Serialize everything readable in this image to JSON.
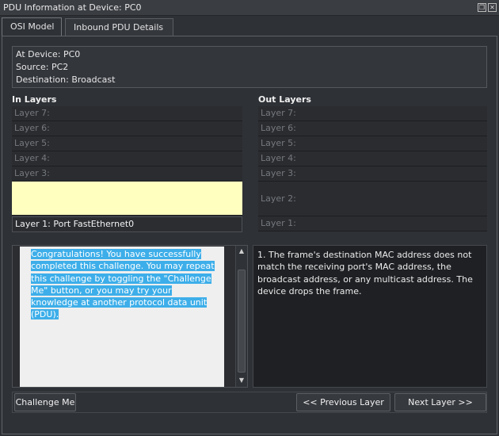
{
  "window": {
    "title": "PDU Information at Device: PC0"
  },
  "tabs": [
    {
      "label": "OSI Model",
      "active": true
    },
    {
      "label": "Inbound PDU Details",
      "active": false
    }
  ],
  "device_info": {
    "at_device": "At Device: PC0",
    "source": "Source: PC2",
    "destination": "Destination: Broadcast"
  },
  "in_layers": {
    "header": "In Layers",
    "layer7": "Layer 7:",
    "layer6": "Layer 6:",
    "layer5": "Layer 5:",
    "layer4": "Layer 4:",
    "layer3": "Layer 3:",
    "layer1": "Layer 1: Port FastEthernet0"
  },
  "out_layers": {
    "header": "Out Layers",
    "layer7": "Layer 7:",
    "layer6": "Layer 6:",
    "layer5": "Layer 5:",
    "layer4": "Layer 4:",
    "layer3": "Layer 3:",
    "layer2": "Layer 2:",
    "layer1": "Layer 1:"
  },
  "challenge_text": "Congratulations! You have successfully completed this challenge. You may repeat this challenge by toggling the \"Challenge Me\" button, or you may try your knowledge at another protocol data unit (PDU).",
  "result_text": "1. The frame's destination MAC address does not match the receiving port's MAC address, the broadcast address, or any multicast address. The device drops the frame.",
  "buttons": {
    "challenge": "Challenge Me",
    "previous": "<< Previous Layer",
    "next": "Next Layer >>"
  },
  "colors": {
    "highlight": "#ffffc0",
    "selection": "#3daee9"
  }
}
